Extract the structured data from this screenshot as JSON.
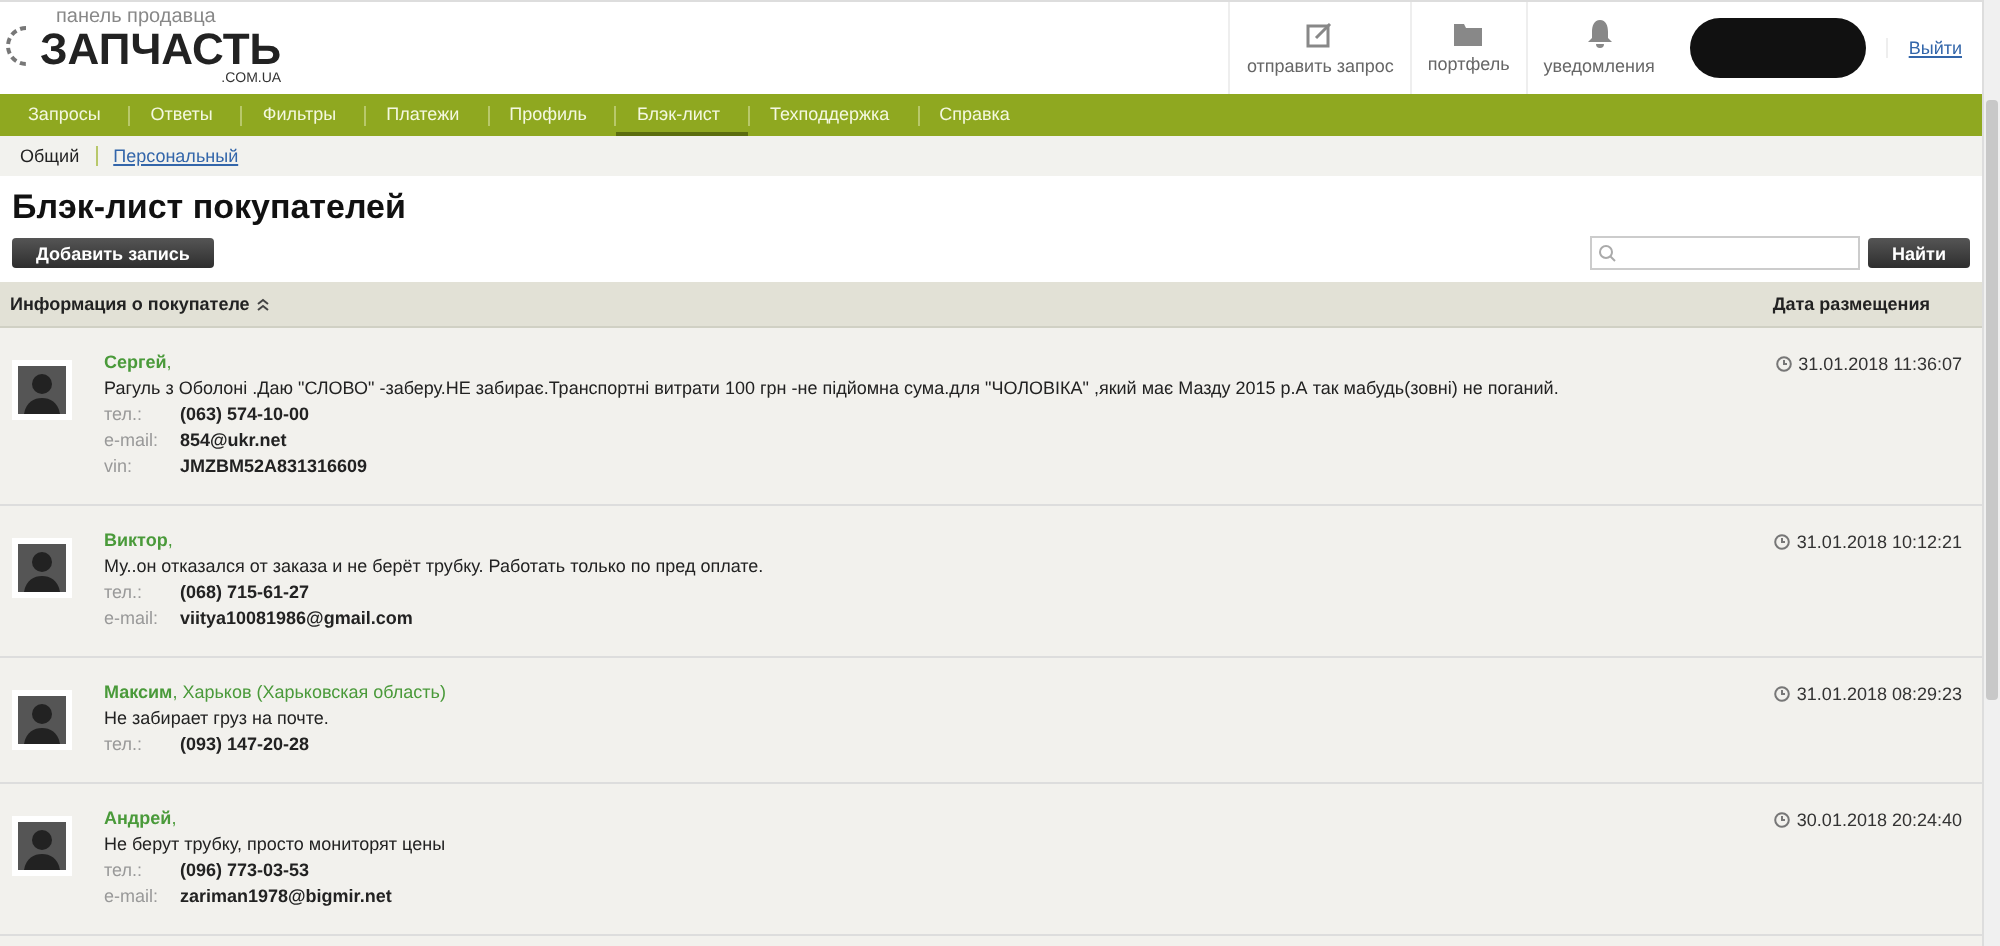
{
  "logo": {
    "caption": "панель продавца",
    "name": "ЗАПЧАСТЬ",
    "domain": ".COM.UA"
  },
  "header_actions": [
    {
      "label": "отправить запрос",
      "kind": "edit"
    },
    {
      "label": "портфель",
      "kind": "folder"
    },
    {
      "label": "уведомления",
      "kind": "bell"
    }
  ],
  "logout": "Выйти",
  "nav": [
    {
      "label": "Запросы",
      "selected": false
    },
    {
      "label": "Ответы",
      "selected": false
    },
    {
      "label": "Фильтры",
      "selected": false
    },
    {
      "label": "Платежи",
      "selected": false
    },
    {
      "label": "Профиль",
      "selected": false
    },
    {
      "label": "Блэк-лист",
      "selected": true
    },
    {
      "label": "Техподдержка",
      "selected": false
    },
    {
      "label": "Справка",
      "selected": false
    }
  ],
  "subnav": [
    {
      "label": "Общий",
      "selected": true
    },
    {
      "label": "Персональный",
      "selected": false
    }
  ],
  "title": "Блэк-лист покупателей",
  "add_button": "Добавить запись",
  "search_button": "Найти",
  "columns": [
    "Информация о покупателе",
    "Дата размещения"
  ],
  "rows": [
    {
      "heading": "**Сергей**,",
      "comment": "Рагуль з Оболоні .Даю \"СЛОВО\" -заберу.НЕ забирає.Транспортні витрати 100 грн -не підйомна сума.для \"ЧОЛОВІКА\" ,який має Мазду 2015 р.А так мабудь(зовні) не поганий.",
      "fields": [
        {
          "label": "тел.:",
          "value": "(063) 574-10-00"
        },
        {
          "label": "e-mail:",
          "value": "854@ukr.net"
        },
        {
          "label": "vin:",
          "value": "JMZBM52A831316609"
        }
      ],
      "date": "31.01.2018 11:36:07"
    },
    {
      "heading": "**Виктор**,",
      "comment": "Му..он отказался от заказа и не берёт трубку. Работать только по пред оплате.",
      "fields": [
        {
          "label": "тел.:",
          "value": "(068) 715-61-27"
        },
        {
          "label": "e-mail:",
          "value": "viitya10081986@gmail.com"
        }
      ],
      "date": "31.01.2018 10:12:21"
    },
    {
      "heading": "**Максим**, Харьков (Харьковская область)",
      "comment": "Не забирает груз на почте.",
      "fields": [
        {
          "label": "тел.:",
          "value": "(093) 147-20-28"
        }
      ],
      "date": "31.01.2018 08:29:23"
    },
    {
      "heading": "**Андрей**,",
      "comment": "Не берут трубку, просто мониторят цены",
      "fields": [
        {
          "label": "тел.:",
          "value": "(096) 773-03-53"
        },
        {
          "label": "e-mail:",
          "value": "zariman1978@bigmir.net"
        }
      ],
      "date": "30.01.2018 20:24:40"
    }
  ]
}
